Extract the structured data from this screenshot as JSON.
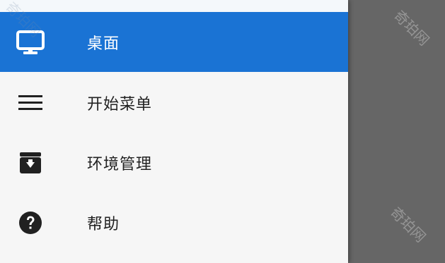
{
  "colors": {
    "active_background": "#1a73d4",
    "drawer_background": "#f6f6f6",
    "overlay_background": "#666666",
    "active_text": "#ffffff",
    "text": "#212121"
  },
  "menu": {
    "items": [
      {
        "label": "桌面",
        "icon": "monitor-icon",
        "active": true
      },
      {
        "label": "开始菜单",
        "icon": "menu-icon",
        "active": false
      },
      {
        "label": "环境管理",
        "icon": "archive-download-icon",
        "active": false
      },
      {
        "label": "帮助",
        "icon": "help-icon",
        "active": false
      }
    ]
  },
  "watermarks": [
    "奇珀网",
    "奇珀网",
    "奇珀网"
  ]
}
